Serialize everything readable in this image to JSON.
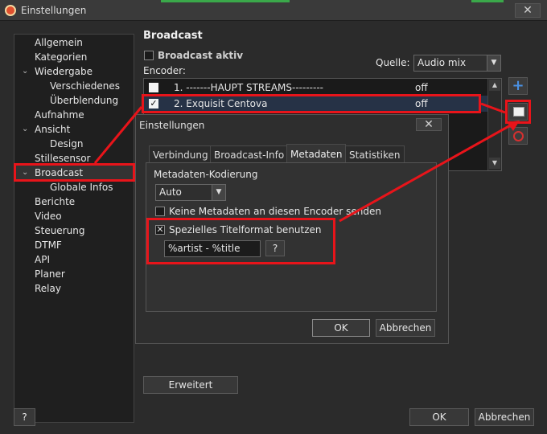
{
  "window": {
    "title": "Einstellungen",
    "close_glyph": "✕"
  },
  "nav": {
    "items": [
      {
        "label": "Allgemein"
      },
      {
        "label": "Kategorien"
      },
      {
        "label": "Wiedergabe"
      },
      {
        "label": "Verschiedenes"
      },
      {
        "label": "Überblendung"
      },
      {
        "label": "Aufnahme"
      },
      {
        "label": "Ansicht"
      },
      {
        "label": "Design"
      },
      {
        "label": "Stillesensor"
      },
      {
        "label": "Broadcast"
      },
      {
        "label": "Globale Infos"
      },
      {
        "label": "Berichte"
      },
      {
        "label": "Video"
      },
      {
        "label": "Steuerung"
      },
      {
        "label": "DTMF"
      },
      {
        "label": "API"
      },
      {
        "label": "Planer"
      },
      {
        "label": "Relay"
      }
    ],
    "selected": "Broadcast"
  },
  "broadcast": {
    "header": "Broadcast",
    "active_label": "Broadcast aktiv",
    "source_label": "Quelle:",
    "source_value": "Audio mix",
    "encoder_label": "Encoder:",
    "encoders": [
      {
        "name": "1. -------HAUPT STREAMS---------",
        "status": "off",
        "checked": false
      },
      {
        "name": "2. Exquisit Centova",
        "status": "off",
        "checked": true
      }
    ],
    "add_glyph": "+",
    "advanced_button": "Erweitert"
  },
  "dialog": {
    "title": "Einstellungen",
    "close_glyph": "✕",
    "tabs": [
      "Verbindung",
      "Broadcast-Info",
      "Metadaten",
      "Statistiken"
    ],
    "active_tab": "Metadaten",
    "encoding_label": "Metadaten-Kodierung",
    "encoding_value": "Auto",
    "no_metadata_label": "Keine Metadaten an diesen Encoder senden",
    "custom_title_label": "Spezielles Titelformat benutzen",
    "title_format_value": "%artist - %title",
    "help_label": "?",
    "ok_label": "OK",
    "cancel_label": "Abbrechen"
  },
  "footer": {
    "help_label": "?",
    "ok_label": "OK",
    "cancel_label": "Abbrechen"
  },
  "colors": {
    "highlight": "#e8141a",
    "selection": "#263246"
  }
}
